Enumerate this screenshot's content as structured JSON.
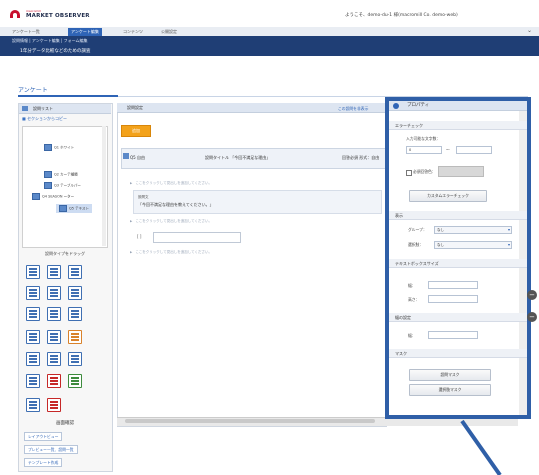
{
  "header": {
    "logo_small": "macromill",
    "logo_text": "MARKET OBSERVER",
    "user_text": "ようこそ、demo-du-1 様(macromill Co. demo-web)"
  },
  "nav": {
    "items": [
      "アンケート一覧",
      "アンケート編集",
      "コンテンツ",
      "公開設定"
    ],
    "active_index": 1
  },
  "subnav": {
    "links": "設問情報 | アンケート編集 | フォーム編集",
    "subtitle": "1年分データ比較などのための調査"
  },
  "page": {
    "heading": "アンケート"
  },
  "left_panel": {
    "header": "設問リスト",
    "section_label": "セクションからコピー",
    "tree": [
      {
        "label": "Q1 ホワイト"
      },
      {
        "label": "Q2 カーテ種類"
      },
      {
        "label": "Q3 テーブルパー"
      },
      {
        "label": "Q4 SEASON ーター"
      },
      {
        "label": "Q5 テキスト"
      }
    ],
    "question_type_label": "設問タイプをドラッグ",
    "preview_heading": "画面確認",
    "buttons": [
      "レイアウトビュー",
      "プレビュー一覧、設問一覧",
      "テンプレート作成"
    ]
  },
  "center_panel": {
    "header": "設問設定",
    "extra_link": "この設問を非表示",
    "add_button": "追加",
    "question": {
      "id": "Q5 自由",
      "title": "設問タイトル 「今回不満足な理由」",
      "meta": "回答必須 形式：自由"
    },
    "hints": [
      "ここをクリックして見出しを追加してください。",
      "ここをクリックして見出しを追加してください。",
      "ここをクリックして見出しを追加してください。"
    ],
    "body_label": "設問文",
    "body_text": "「今回不満足な理由を教えてください。」",
    "answer_bracket": "[ ]"
  },
  "property_panel": {
    "header": "プロパティ",
    "sections": {
      "error_check": "エラーチェック",
      "display": "表示",
      "text_area": "テキストボックスサイズ",
      "width_sec": "幅の設定",
      "mask": "マスク"
    },
    "min_chars_label": "入力可能な文字数：",
    "min_val": "0",
    "tilde": "〜",
    "required_label": "必須回答",
    "color_label": "色：",
    "custom_check_button": "カスタムエラーチェック",
    "group_label": "グループ：",
    "group_value": "なし",
    "select_label": "選択肢：",
    "select_value": "なし",
    "width_label": "幅：",
    "height_label": "高さ：",
    "width2_label": "幅：",
    "mask_button_1": "設問マスク",
    "mask_button_2": "選択肢マスク"
  },
  "colors": {
    "brand": "#c8102e",
    "nav_active": "#2f64b6",
    "subnav_bg": "#1f3e75",
    "highlight_border": "#2f5fa7",
    "add_button": "#f3a21b"
  }
}
